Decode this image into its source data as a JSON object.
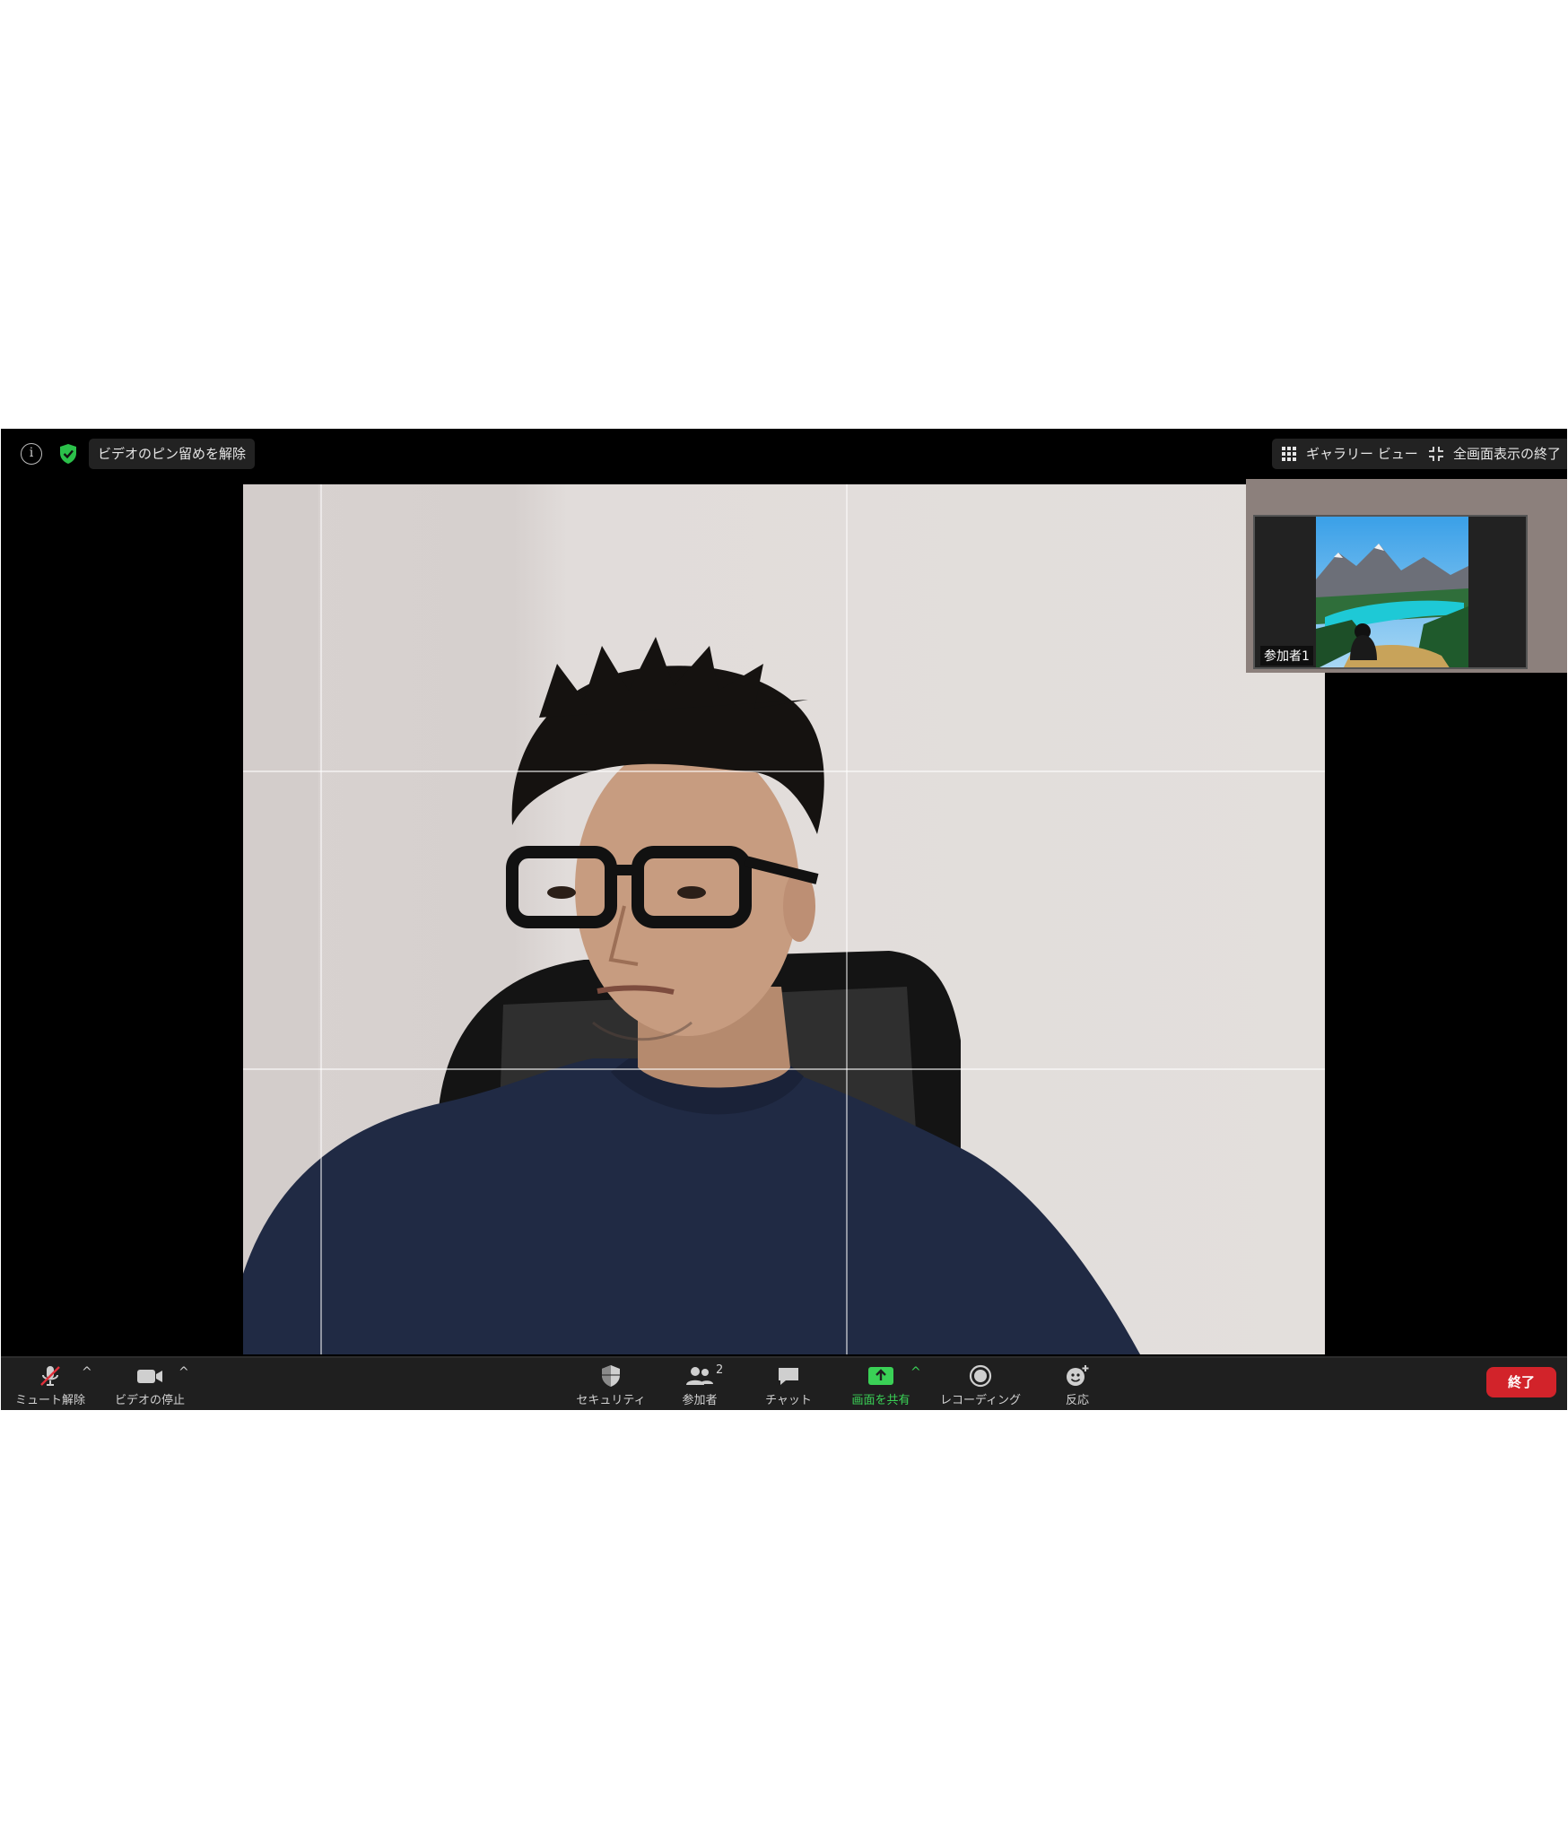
{
  "topbar": {
    "info_icon": "info-icon",
    "security_icon": "shield-check-icon",
    "unpin_label": "ビデオのピン留めを解除",
    "gallery_label": "ギャラリー ビュー",
    "exit_fullscreen_label": "全画面表示の終了"
  },
  "thumbnail": {
    "participant_label": "参加者1"
  },
  "toolbar": {
    "mute_label": "ミュート解除",
    "video_label": "ビデオの停止",
    "security_label": "セキュリティ",
    "participants_label": "参加者",
    "participants_count": "2",
    "chat_label": "チャット",
    "share_label": "画面を共有",
    "record_label": "レコーディング",
    "reactions_label": "反応",
    "end_label": "終了"
  },
  "colors": {
    "accent_green": "#3ad156",
    "end_red": "#d2232a",
    "bar_bg": "#1f1f1f"
  }
}
